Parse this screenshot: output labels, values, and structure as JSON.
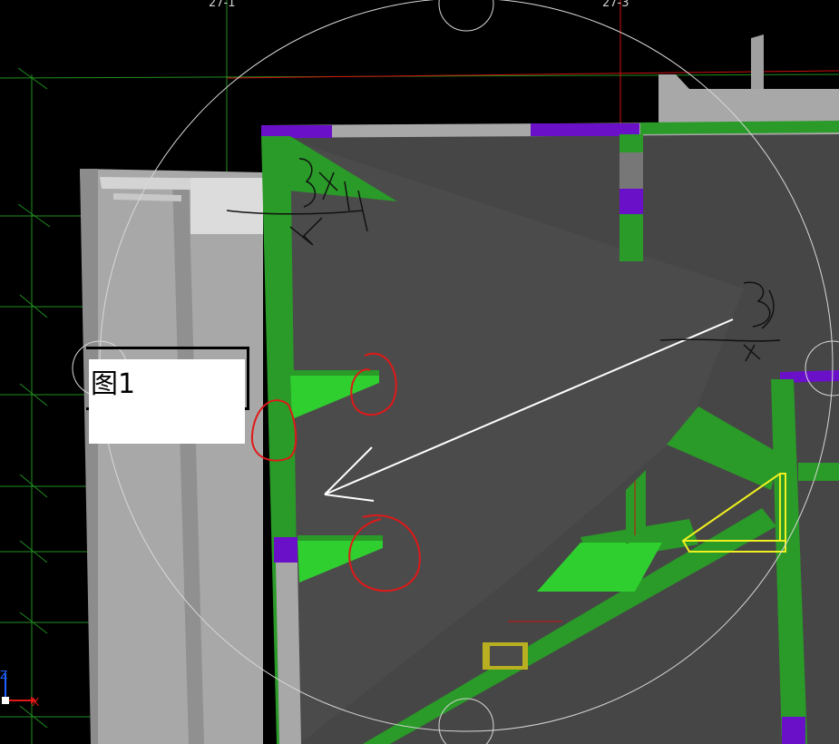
{
  "grid_labels": {
    "left": "27-1",
    "right": "27-3"
  },
  "figure_label": "图1",
  "axis": {
    "z": "Z",
    "x": "X"
  },
  "handwritten": {
    "upper_left": "3#",
    "right": "3#"
  },
  "colors": {
    "background": "#000000",
    "grid_green": "#1f8f1f",
    "grid_red": "#d01010",
    "beam_green": "#2a9a28",
    "bright_green": "#2fcf2f",
    "column_purple": "#6a10c8",
    "slab_gray": "#464646",
    "wall_gray": "#a8a8a8",
    "highlight_yellow": "#f0f020",
    "annotation_red": "#e01818"
  }
}
